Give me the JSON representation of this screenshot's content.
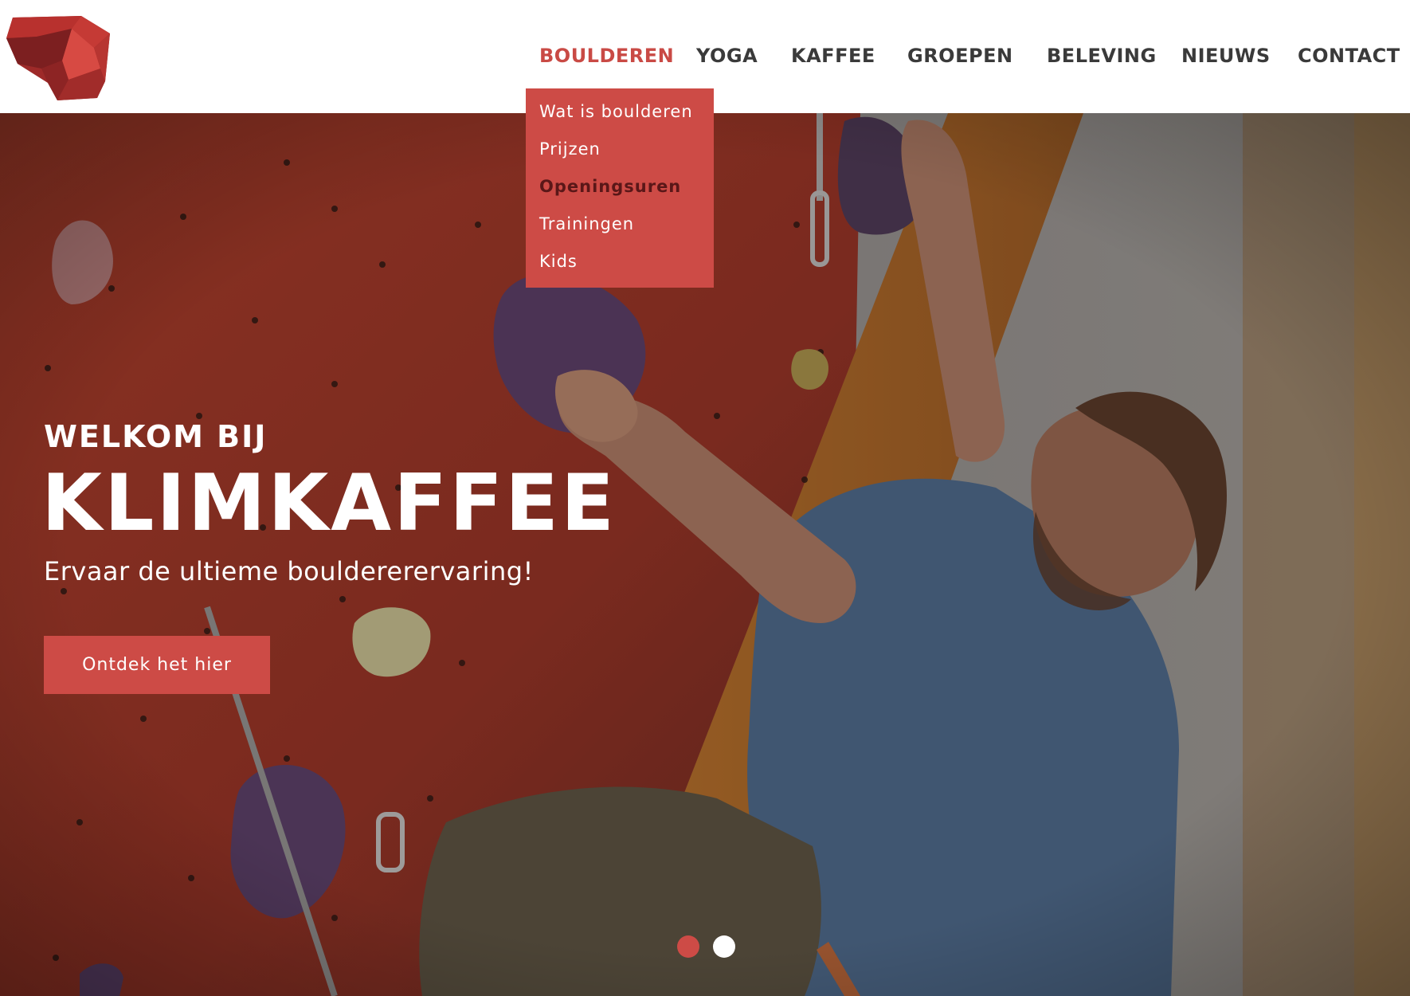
{
  "brand": {
    "logo_icon": "boulder-logo",
    "accent_color": "#cd4b46"
  },
  "nav": {
    "items": [
      {
        "label": "BOULDEREN",
        "active": true
      },
      {
        "label": "YOGA"
      },
      {
        "label": "KAFFEE"
      },
      {
        "label": "GROEPEN"
      },
      {
        "label": "BELEVING"
      },
      {
        "label": "NIEUWS"
      },
      {
        "label": "CONTACT"
      }
    ]
  },
  "dropdown": {
    "items": [
      {
        "label": "Wat is boulderen"
      },
      {
        "label": "Prijzen"
      },
      {
        "label": "Openingsuren",
        "current": true
      },
      {
        "label": "Trainingen"
      },
      {
        "label": "Kids"
      }
    ]
  },
  "hero": {
    "subtitle": "WELKOM BIJ",
    "title": "KLIMKAFFEE",
    "tagline": "Ervaar de ultieme bouldererervaring!",
    "cta_label": "Ontdek het hier"
  },
  "carousel": {
    "slide_count": 2,
    "active_slide": 1
  }
}
